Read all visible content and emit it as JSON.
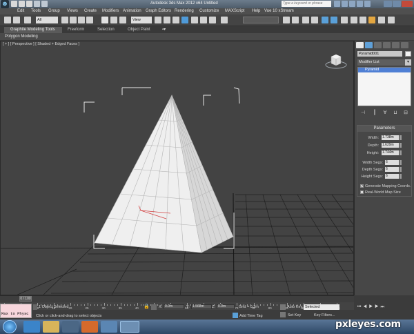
{
  "titlebar": {
    "title": "Autodesk 3ds Max 2012 x64      Untitled",
    "search_placeholder": "Type a keyword or phrase"
  },
  "menu": [
    "Edit",
    "Tools",
    "Group",
    "Views",
    "Create",
    "Modifiers",
    "Animation",
    "Graph Editors",
    "Rendering",
    "Customize",
    "MAXScript",
    "Help",
    "Vue 10 xStream"
  ],
  "toolbar": {
    "filter_value": "All",
    "coord_value": "View"
  },
  "ribbon": {
    "tabs": [
      "Graphite Modeling Tools",
      "Freeform",
      "Selection",
      "Object Paint"
    ],
    "active_tab": "Graphite Modeling Tools",
    "panel_label": "Polygon Modeling"
  },
  "viewport": {
    "label": "[ + ] [ Perspective ] [ Shaded + Edged Faces ]"
  },
  "command_panel": {
    "object_name": "Pyramid001",
    "modifier_list": "Modifier List",
    "stack_items": [
      "Pyramid"
    ],
    "parameters": {
      "header": "Parameters",
      "width_label": "Width:",
      "width_value": "1.738m",
      "depth_label": "Depth:",
      "depth_value": "1.629m",
      "height_label": "Height:",
      "height_value": "1.744m",
      "width_segs_label": "Width Segs:",
      "width_segs_value": "6",
      "depth_segs_label": "Depth Segs:",
      "depth_segs_value": "6",
      "height_segs_label": "Height Segs:",
      "height_segs_value": "6",
      "gen_mapping": "Generate Mapping Coords.",
      "gen_mapping_checked": true,
      "real_world": "Real-World Map Size",
      "real_world_checked": false
    }
  },
  "timeline": {
    "frame_display": "0 / 100",
    "ticks": [
      "0",
      "5",
      "10",
      "15",
      "20",
      "25",
      "30",
      "35",
      "40",
      "45",
      "50",
      "55",
      "60",
      "65",
      "70",
      "75",
      "80",
      "85",
      "90",
      "95",
      "100"
    ]
  },
  "status": {
    "maxscript_text": "Max to Physc",
    "selection_status": "1 Object Selected",
    "prompt": "Click or click-and-drag to select objects",
    "x_label": "X:",
    "x_value": "0.0m",
    "y_label": "Y:",
    "y_value": "1.568m",
    "z_label": "Z:",
    "z_value": "0.0m",
    "grid": "Grid = 0.2m",
    "add_time_tag": "Add Time Tag",
    "auto_key": "Auto Key",
    "selected_dd": "Selected",
    "set_key": "Set Key",
    "key_filters": "Key Filters..."
  },
  "watermark": "pxleyes.com",
  "colors": {
    "accent_blue": "#4f7fd4",
    "viewport_bg": "#434343",
    "pyramid_face": "#f0f0f0"
  }
}
